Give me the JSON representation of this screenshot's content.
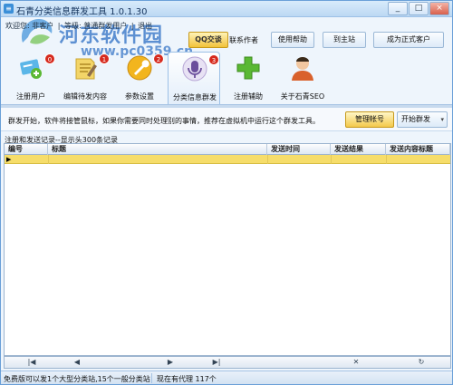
{
  "window": {
    "title": "石青分类信息群发工具 1.0.1.30",
    "min": "_",
    "max": "□",
    "close": "×"
  },
  "watermark": {
    "title": "河东软件园",
    "url": "www.pc0359.cn"
  },
  "welcome": {
    "prefix": "欢迎您:",
    "user": "非客户",
    "sep": "|",
    "level_label": "等级:",
    "level": "普通群发用户",
    "logout": "退出"
  },
  "top_buttons": {
    "qq": "QQ交谈",
    "contact": "联系作者",
    "help": "使用帮助",
    "home": "到主站",
    "become": "成为正式客户"
  },
  "toolbar": {
    "items": [
      {
        "label": "注册用户",
        "badge": "0"
      },
      {
        "label": "编辑待发内容",
        "badge": "1"
      },
      {
        "label": "参数设置",
        "badge": "2"
      },
      {
        "label": "分类信息群发",
        "badge": "3"
      },
      {
        "label": "注册辅助"
      },
      {
        "label": "关于石青SEO"
      }
    ]
  },
  "info": {
    "text": "群发开始，软件将接管鼠标，如果你需要同时处理别的事情，推荐在虚拟机中运行这个群发工具。",
    "manage": "管理帐号",
    "start": "开始群发",
    "start_caret": "▾"
  },
  "records": {
    "label": "注册和发送记录--显示头300条记录",
    "columns": [
      "编号",
      "标题",
      "发送时间",
      "发送结果",
      "发送内容标题"
    ],
    "row_marker": "▶"
  },
  "scrollbar": {
    "first": "|◀",
    "prev": "◀",
    "next": "▶",
    "last": "▶|",
    "cancel": "✕",
    "refresh": "↻"
  },
  "status": {
    "left": "免费版可以发1个大型分类站,15个一般分类站",
    "right": "现在有代理 117个"
  },
  "colors": {
    "accent": "#2d6fc4",
    "selected_row": "#f6dd6a",
    "badge": "#d62a1e"
  }
}
